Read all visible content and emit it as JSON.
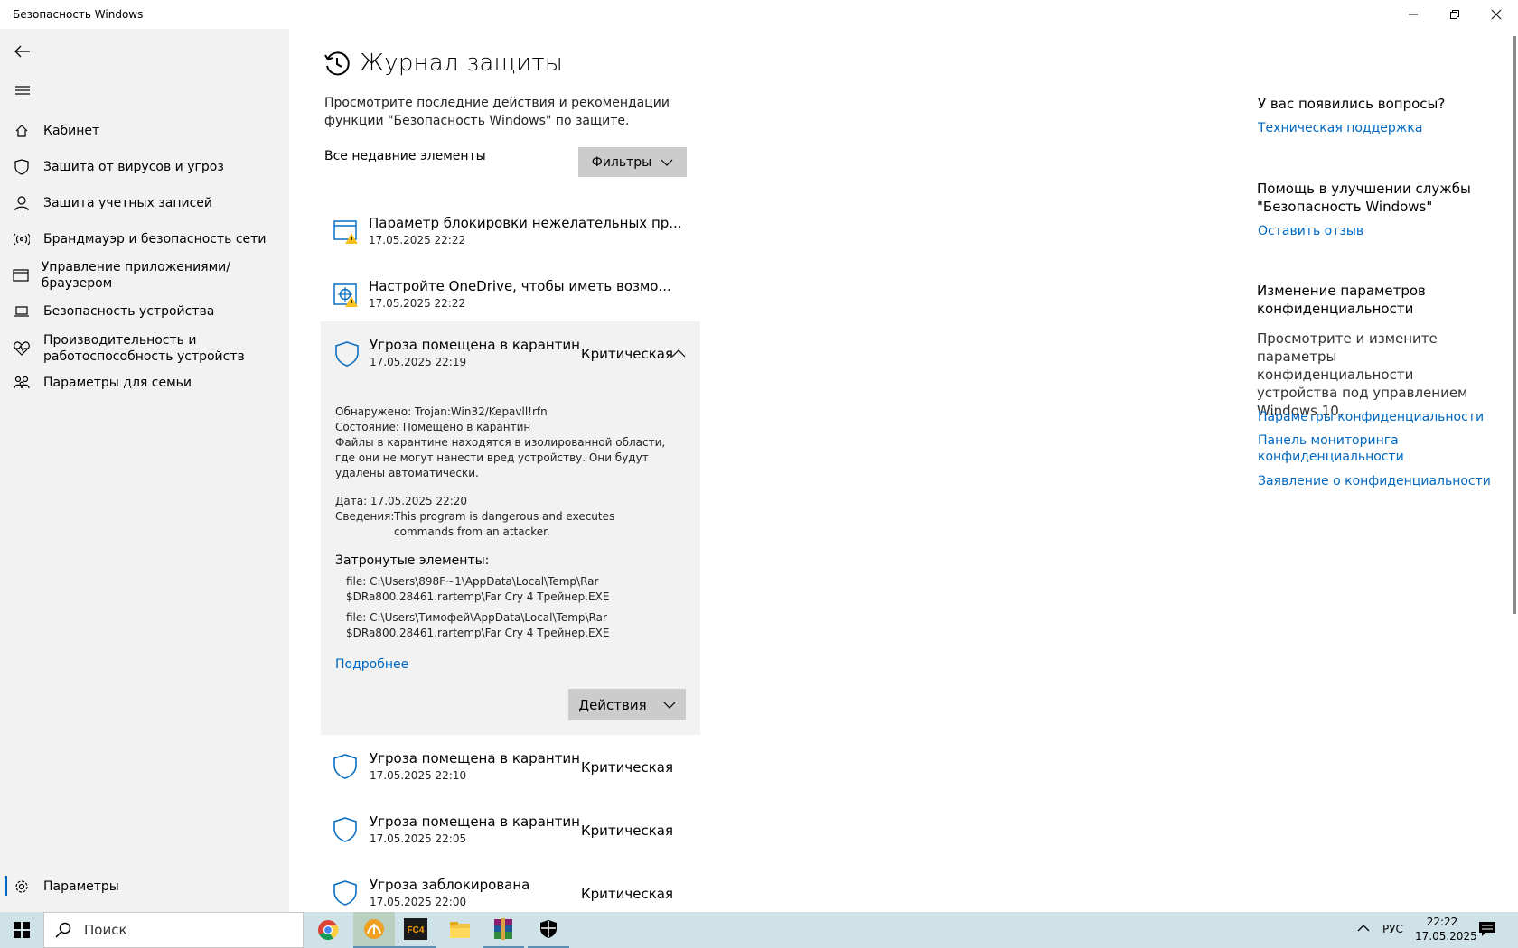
{
  "window": {
    "title": "Безопасность Windows"
  },
  "sidebar": {
    "items": [
      {
        "label": "Кабинет"
      },
      {
        "label": "Защита от вирусов и угроз"
      },
      {
        "label": "Защита учетных записей"
      },
      {
        "label": "Брандмауэр и безопасность сети"
      },
      {
        "label": "Управление приложениями/браузером"
      },
      {
        "label": "Безопасность устройства"
      },
      {
        "label": "Производительность и\nработоспособность устройств"
      },
      {
        "label": "Параметры для семьи"
      }
    ],
    "settings_label": "Параметры"
  },
  "main": {
    "title": "Журнал защиты",
    "description": "Просмотрите последние действия и рекомендации функции \"Безопасность Windows\" по защите.",
    "list_heading": "Все недавние элементы",
    "filters_label": "Фильтры",
    "items": [
      {
        "title": "Параметр блокировки нежелательных пр...",
        "date": "17.05.2025 22:22",
        "icon": "app-browser-warning-icon"
      },
      {
        "title": "Настройте OneDrive, чтобы иметь возмо...",
        "date": "17.05.2025 22:22",
        "icon": "virus-protection-warning-icon"
      }
    ],
    "expanded": {
      "title": "Угроза помещена в карантин",
      "date": "17.05.2025 22:19",
      "severity": "Критическая",
      "detected_label": "Обнаружено:",
      "detected_value": "Trojan:Win32/Kepavll!rfn",
      "status_label": "Состояние:",
      "status_value": "Помещено в карантин",
      "explanation": "Файлы в карантине находятся в изолированной области, где они не могут нанести вред устройству. Они будут удалены автоматически.",
      "date_line": "Дата: 17.05.2025 22:20",
      "details_label": "Сведения:",
      "details_value": "This program is dangerous and executes commands from an attacker.",
      "affected_heading": "Затронутые элементы:",
      "affected": [
        "file: C:\\Users\\898F~1\\AppData\\Local\\Temp\\Rar\n$DRa800.28461.rartemp\\Far Cry 4 Трейнер.EXE",
        "file: C:\\Users\\Тимофей\\AppData\\Local\\Temp\\Rar\n$DRa800.28461.rartemp\\Far Cry 4 Трейнер.EXE"
      ],
      "more_link": "Подробнее",
      "actions_label": "Действия"
    },
    "threats": [
      {
        "title": "Угроза помещена в карантин",
        "date": "17.05.2025 22:10",
        "severity": "Критическая"
      },
      {
        "title": "Угроза помещена в карантин",
        "date": "17.05.2025 22:05",
        "severity": "Критическая"
      },
      {
        "title": "Угроза заблокирована",
        "date": "17.05.2025 22:00",
        "severity": "Критическая"
      }
    ]
  },
  "right_panel": {
    "questions_heading": "У вас появились вопросы?",
    "support_link": "Техническая поддержка",
    "improve_heading": "Помощь в улучшении службы \"Безопасность Windows\"",
    "feedback_link": "Оставить отзыв",
    "privacy_heading": "Изменение параметров конфиденциальности",
    "privacy_text": "Просмотрите и измените параметры конфиденциальности устройства под управлением Windows 10.",
    "links": [
      "Параметры конфиденциальности",
      "Панель мониторинга конфиденциальности",
      "Заявление о конфиденциальности"
    ]
  },
  "taskbar": {
    "search_placeholder": "Поиск",
    "apps": [
      "chrome",
      "media-player",
      "FC4",
      "file-explorer",
      "winrar",
      "windows-security"
    ],
    "language": "РУС",
    "time": "22:22",
    "date": "17.05.2025"
  },
  "colors": {
    "accent": "#0067c0",
    "sidebar_bg": "#f2f2f2",
    "taskbar_bg": "#cfe2e8"
  }
}
